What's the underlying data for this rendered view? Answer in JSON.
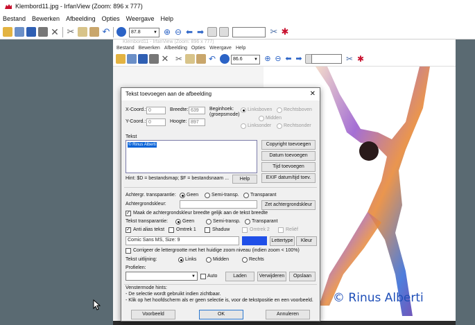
{
  "window": {
    "title": "Klembord11.jpg - IrfanView (Zoom: 896 x 777)"
  },
  "menu": [
    "Bestand",
    "Bewerken",
    "Afbeelding",
    "Opties",
    "Weergave",
    "Help"
  ],
  "toolbar": {
    "zoom_value": "87.8"
  },
  "inner": {
    "title": "Klembord11 - IrfanView (Zoom: 896 x 777)",
    "menu": [
      "Bestand",
      "Bewerken",
      "Afbeelding",
      "Opties",
      "Weergave",
      "Help"
    ],
    "zoom_value": "86.6",
    "watermark": "© Rinus Alberti"
  },
  "dialog": {
    "title": "Tekst toevoegen aan de afbeelding",
    "close": "✕",
    "xcoord_label": "X-Coord.:",
    "xcoord_value": "0",
    "ycoord_label": "Y-Coord.:",
    "ycoord_value": "0",
    "breedte_label": "Breedte:",
    "breedte_value": "639",
    "hoogte_label": "Hoogte:",
    "hoogte_value": "897",
    "beginhoek_label": "Beginhoek:",
    "groepsmode_label": "(groepsmode)",
    "corners": [
      "Linksboven",
      "Rechtsboven",
      "Midden",
      "Linksonder",
      "Rechtsonder"
    ],
    "tekst_label": "Tekst",
    "tekst_value": "© Rinus Alberti",
    "btn_copyright": "Copyright toevoegen",
    "btn_datum": "Datum toevoegen",
    "btn_tijd": "Tijd toevoegen",
    "btn_exif": "EXIF datum/tijd toev.",
    "hint": "Hint: $D = bestandsmap; $F = bestandsnaam ...",
    "btn_help": "Help",
    "achtergr_transp_label": "Achtergr. transparantie:",
    "transp_options": [
      "Geen",
      "Semi-transp.",
      "Transparant"
    ],
    "achtergrondskleur_label": "Achtergrondskleur:",
    "btn_zet_achtergrond": "Zet achtergrondskleur",
    "maak_breedte_label": "Maak de achtergrondskleur breedte gelijk aan de tekst breedte",
    "tekst_transp_label": "Tekst transparantie:",
    "tekst_transp_options": [
      "Geen",
      "Semi-transp.",
      "Transparant"
    ],
    "anti_alias_label": "Anti alias tekst",
    "omtrek1_label": "Omtrek 1",
    "shaduw_label": "Shaduw",
    "omtrek2_label": "Omtrek 2",
    "reliëf_label": "Reliëf",
    "font_value": "Comic Sans MS, Size: 9",
    "font_color": "#1f4fe8",
    "btn_lettertype": "Lettertype",
    "btn_kleur": "Kleur",
    "corrigeer_label": "Corrigeer de lettergrootte met het huidige zoom niveau (indien zoom < 100%)",
    "uitlijning_label": "Tekst uitlijning:",
    "uitlijning_options": [
      "Links",
      "Midden",
      "Rechts"
    ],
    "profielen_label": "Profielen:",
    "auto_label": "Auto",
    "btn_laden": "Laden",
    "btn_verwijderen": "Verwijderen",
    "btn_opslaan": "Opslaan",
    "hints_title": "Venstermode hints:",
    "hint1": "- De selectie wordt gebruikt indien zichtbaar.",
    "hint2": "- Klik op het hoofdscherm als er geen selectie is, voor de tekstpositie en een voorbeeld.",
    "btn_voorbeeld": "Voorbeeld",
    "btn_ok": "OK",
    "btn_annuleren": "Annuleren"
  }
}
